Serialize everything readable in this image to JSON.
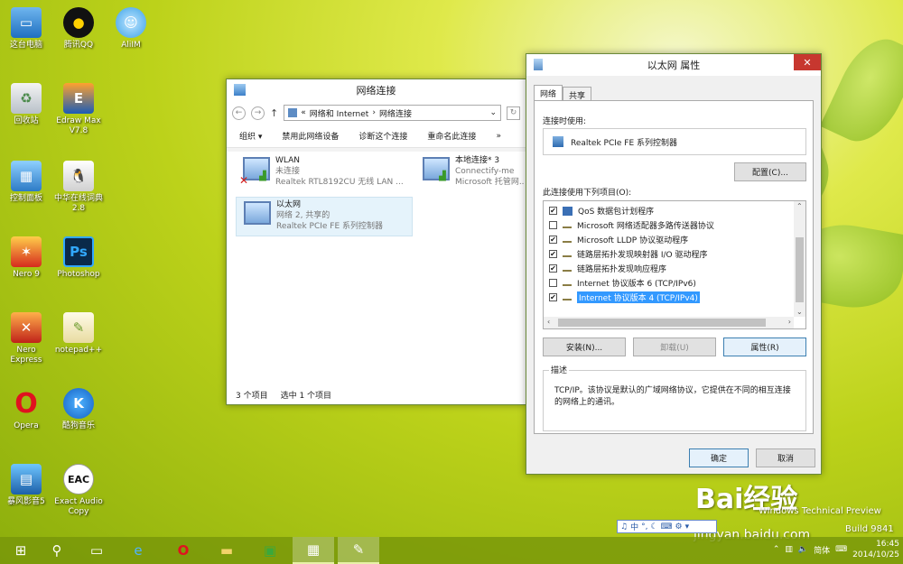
{
  "desktop": {
    "icons": [
      {
        "label": "这台电脑",
        "icon": "computer-icon"
      },
      {
        "label": "腾讯QQ",
        "icon": "qq-icon"
      },
      {
        "label": "AliIM",
        "icon": "aliim-icon"
      },
      {
        "label": "回收站",
        "icon": "recycle-bin-icon"
      },
      {
        "label": "Edraw Max V7.8",
        "icon": "edraw-icon"
      },
      {
        "label": "控制面板",
        "icon": "control-panel-icon"
      },
      {
        "label": "中华在线词典2.8",
        "icon": "dictionary-icon"
      },
      {
        "label": "Nero 9",
        "icon": "nero-icon"
      },
      {
        "label": "Photoshop",
        "icon": "photoshop-icon"
      },
      {
        "label": "Nero Express",
        "icon": "nero-express-icon"
      },
      {
        "label": "notepad++",
        "icon": "notepad-icon"
      },
      {
        "label": "Opera",
        "icon": "opera-icon"
      },
      {
        "label": "酷狗音乐",
        "icon": "kugou-icon"
      },
      {
        "label": "暴风影音5",
        "icon": "baofeng-icon"
      },
      {
        "label": "Exact Audio Copy",
        "icon": "eac-icon"
      }
    ]
  },
  "network_window": {
    "title": "网络连接",
    "breadcrumb": {
      "prefix": "«",
      "part1": "网络和 Internet",
      "sep": "›",
      "part2": "网络连接"
    },
    "toolbar": {
      "organize": "组织 ▾",
      "disable": "禁用此网络设备",
      "diagnose": "诊断这个连接",
      "rename": "重命名此连接",
      "more": "»"
    },
    "items": [
      {
        "name": "WLAN",
        "status": "未连接",
        "device": "Realtek RTL8192CU 无线 LAN ..."
      },
      {
        "name": "本地连接* 3",
        "status": "Connectify-me",
        "device": "Microsoft 托管网..."
      },
      {
        "name": "以太网",
        "status": "网络 2, 共享的",
        "device": "Realtek PCIe FE 系列控制器"
      }
    ],
    "status": {
      "count": "3 个项目",
      "selected": "选中 1 个项目"
    }
  },
  "properties_window": {
    "title": "以太网 属性",
    "tabs": [
      "网络",
      "共享"
    ],
    "connect_using_label": "连接时使用:",
    "adapter": "Realtek PCIe FE 系列控制器",
    "configure_button": "配置(C)...",
    "items_label": "此连接使用下列项目(O):",
    "items": [
      {
        "label": "QoS 数据包计划程序",
        "checked": true
      },
      {
        "label": "Microsoft 网络适配器多路传送器协议",
        "checked": false
      },
      {
        "label": "Microsoft LLDP 协议驱动程序",
        "checked": true
      },
      {
        "label": "链路层拓扑发现映射器 I/O 驱动程序",
        "checked": true
      },
      {
        "label": "链路层拓扑发现响应程序",
        "checked": true
      },
      {
        "label": "Internet 协议版本 6 (TCP/IPv6)",
        "checked": false
      },
      {
        "label": "Internet 协议版本 4 (TCP/IPv4)",
        "checked": true
      }
    ],
    "install_button": "安装(N)...",
    "uninstall_button": "卸载(U)",
    "properties_button": "属性(R)",
    "description_legend": "描述",
    "description_text": "TCP/IP。该协议是默认的广域网络协议，它提供在不同的相互连接的网络上的通讯。",
    "ok_button": "确定",
    "cancel_button": "取消"
  },
  "taskbar": {
    "ime": "中",
    "clock_time": "16:45",
    "clock_date": "2014/10/25",
    "tray_ime": "简体",
    "tray_build": "Build 9841",
    "tray_preview": "Windows Technical Preview"
  },
  "watermark": {
    "brand": "Bai经验",
    "url": "jingyan.baidu.com"
  },
  "colors": {
    "accent": "#3399ff",
    "close": "#c7372f",
    "desktop": "#bcd21a"
  }
}
